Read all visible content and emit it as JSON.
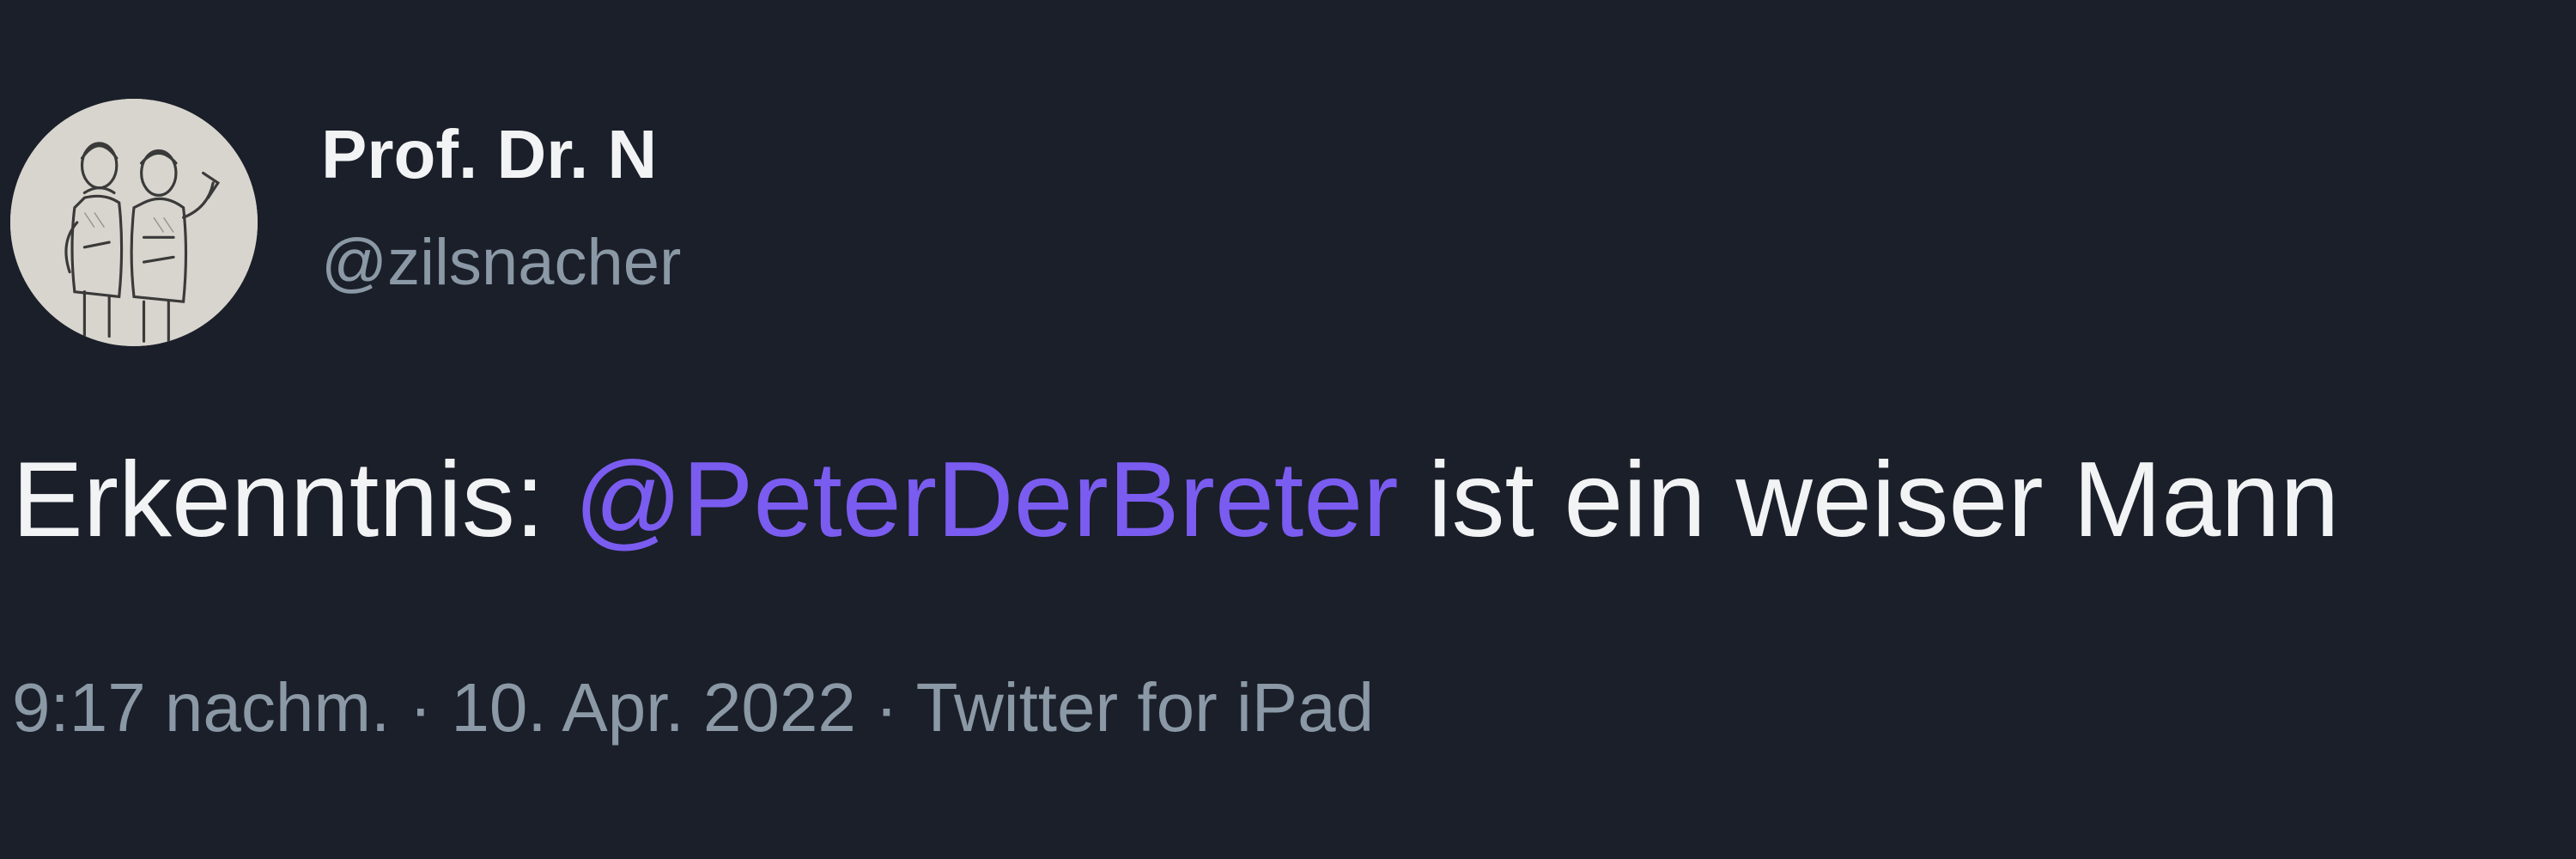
{
  "tweet": {
    "author": {
      "name": "Prof. Dr. N",
      "handle": "@zilsnacher",
      "avatar_icon": "sketch-portrait-avatar"
    },
    "text": {
      "prefix": "Erkenntnis: ",
      "mention": "@PeterDerBreter",
      "suffix": " ist ein weiser Mann"
    },
    "meta": {
      "time": "9:17 nachm.",
      "separator": " · ",
      "date": "10. Apr. 2022",
      "source": "Twitter for iPad"
    }
  },
  "colors": {
    "background": "#1a1f29",
    "text": "#f2f3f4",
    "secondary_text": "#8b98a5",
    "mention": "#7b5cf0"
  }
}
